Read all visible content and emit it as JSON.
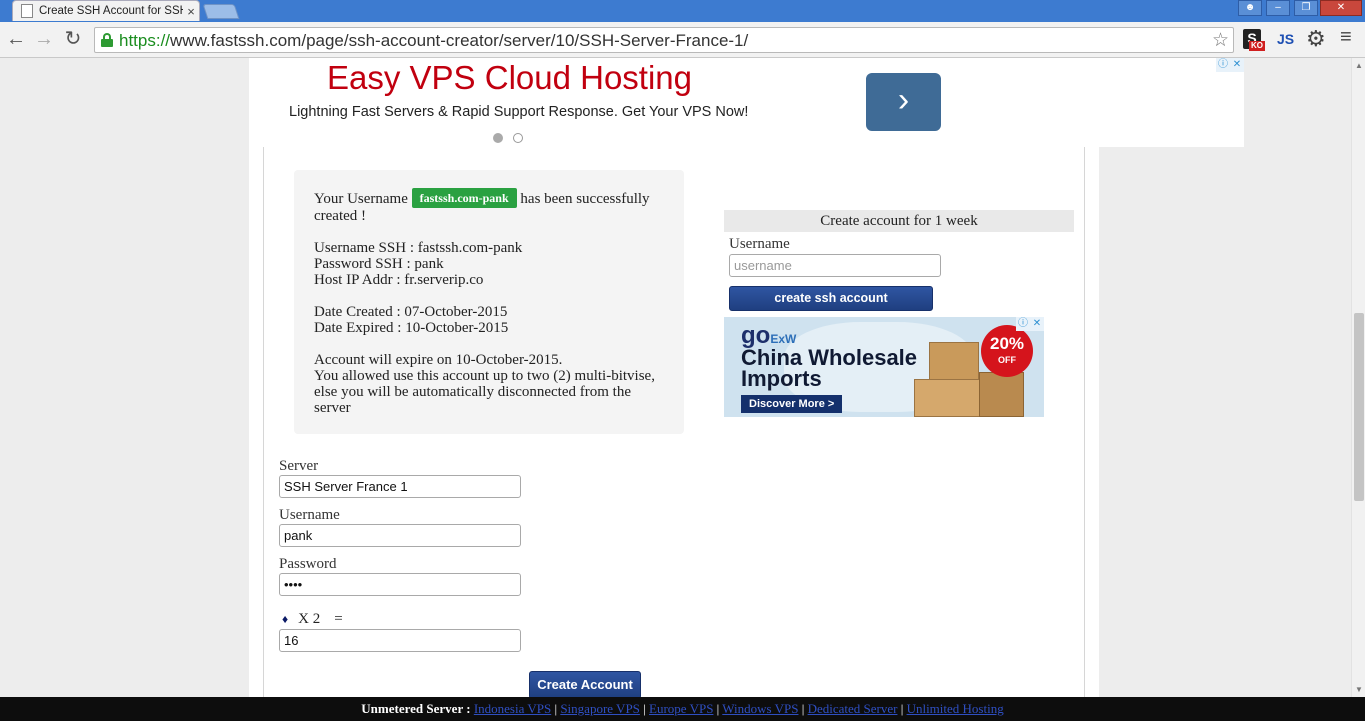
{
  "browser": {
    "tab_title": "Create SSH Account for SSH",
    "tab_close": "×",
    "url_scheme": "https://",
    "url_rest": "www.fastssh.com/page/ssh-account-creator/server/10/SSH-Server-France-1/",
    "ext_s_label": "S",
    "ext_s_badge": "KO",
    "ext_js_label": "JS"
  },
  "ad_top": {
    "title": "Easy VPS Cloud Hosting",
    "subtitle": "Lightning Fast Servers & Rapid Support Response. Get Your VPS Now!"
  },
  "account_info": {
    "intro_prefix": "Your Username",
    "username_badge": "fastssh.com-pank",
    "intro_suffix": "has been successfully created !",
    "username_line": "Username SSH : fastssh.com-pank",
    "password_line": "Password SSH : pank",
    "host_line": "Host IP Addr : fr.serverip.co",
    "created_line": "Date Created : 07-October-2015",
    "expired_line": "Date Expired : 10-October-2015",
    "expire_notice": "Account will expire on 10-October-2015.",
    "usage_notice": "You allowed use this account up to two (2) multi-bitvise, else you will be automatically disconnected from the server"
  },
  "week_form": {
    "heading": "Create account for 1 week",
    "username_label": "Username",
    "username_placeholder": "username",
    "submit_label": "create ssh account"
  },
  "ad_side": {
    "logo_main": "go",
    "logo_sub": "ExW",
    "headline_1": "China Wholesale",
    "headline_2": "Imports",
    "cta": "Discover More >",
    "promo_pct": "20%",
    "promo_off": "OFF"
  },
  "main_form": {
    "server_label": "Server",
    "server_value": "SSH Server France 1",
    "username_label": "Username",
    "username_value": "pank",
    "password_label": "Password",
    "password_value": "••••",
    "captcha_operand": "X 2",
    "captcha_eq": "=",
    "captcha_value": "16",
    "submit_label": "Create Account"
  },
  "footer": {
    "lead": "Unmetered Server :",
    "links": [
      "Indonesia VPS",
      "Singapore VPS",
      "Europe VPS",
      "Windows VPS",
      "Dedicated Server",
      "Unlimited Hosting"
    ]
  }
}
